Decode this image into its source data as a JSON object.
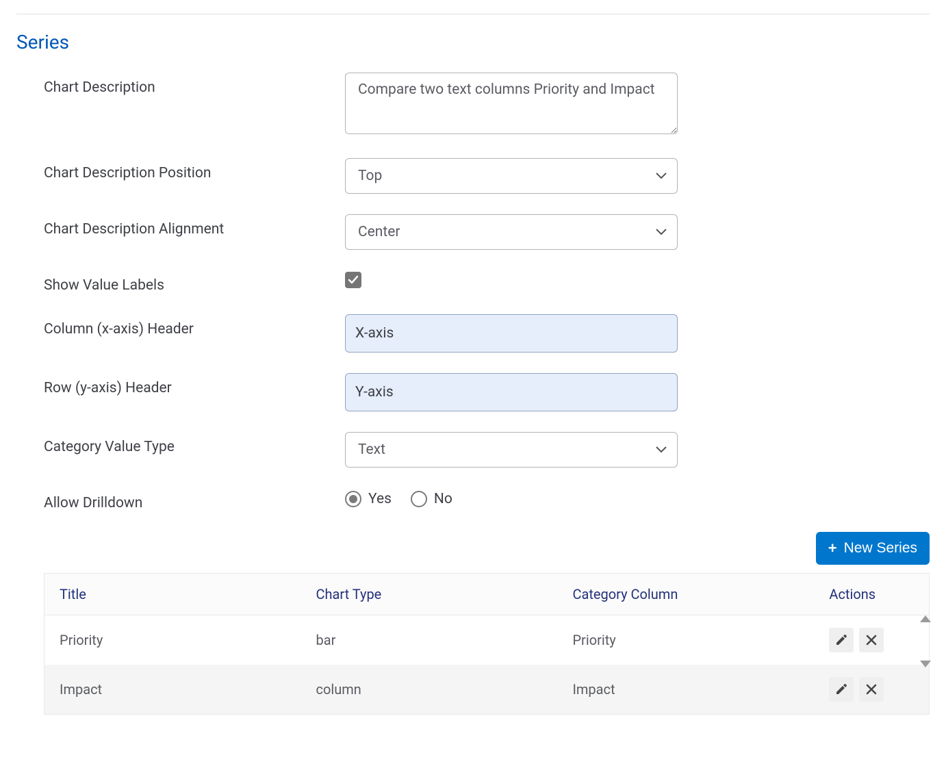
{
  "section": {
    "title": "Series"
  },
  "form": {
    "chart_description": {
      "label": "Chart Description",
      "value": "Compare two text columns Priority and Impact"
    },
    "chart_description_position": {
      "label": "Chart Description Position",
      "value": "Top"
    },
    "chart_description_alignment": {
      "label": "Chart Description Alignment",
      "value": "Center"
    },
    "show_value_labels": {
      "label": "Show Value Labels",
      "checked": true
    },
    "column_header": {
      "label": "Column (x-axis) Header",
      "value": "X-axis"
    },
    "row_header": {
      "label": "Row (y-axis) Header",
      "value": "Y-axis"
    },
    "category_value_type": {
      "label": "Category Value Type",
      "value": "Text"
    },
    "allow_drilldown": {
      "label": "Allow Drilldown",
      "options": {
        "yes": "Yes",
        "no": "No"
      },
      "selected": "yes"
    }
  },
  "buttons": {
    "new_series": "New Series"
  },
  "table": {
    "headers": {
      "title": "Title",
      "chart_type": "Chart Type",
      "category_column": "Category Column",
      "actions": "Actions"
    },
    "rows": [
      {
        "title": "Priority",
        "chart_type": "bar",
        "category_column": "Priority"
      },
      {
        "title": "Impact",
        "chart_type": "column",
        "category_column": "Impact"
      }
    ]
  }
}
